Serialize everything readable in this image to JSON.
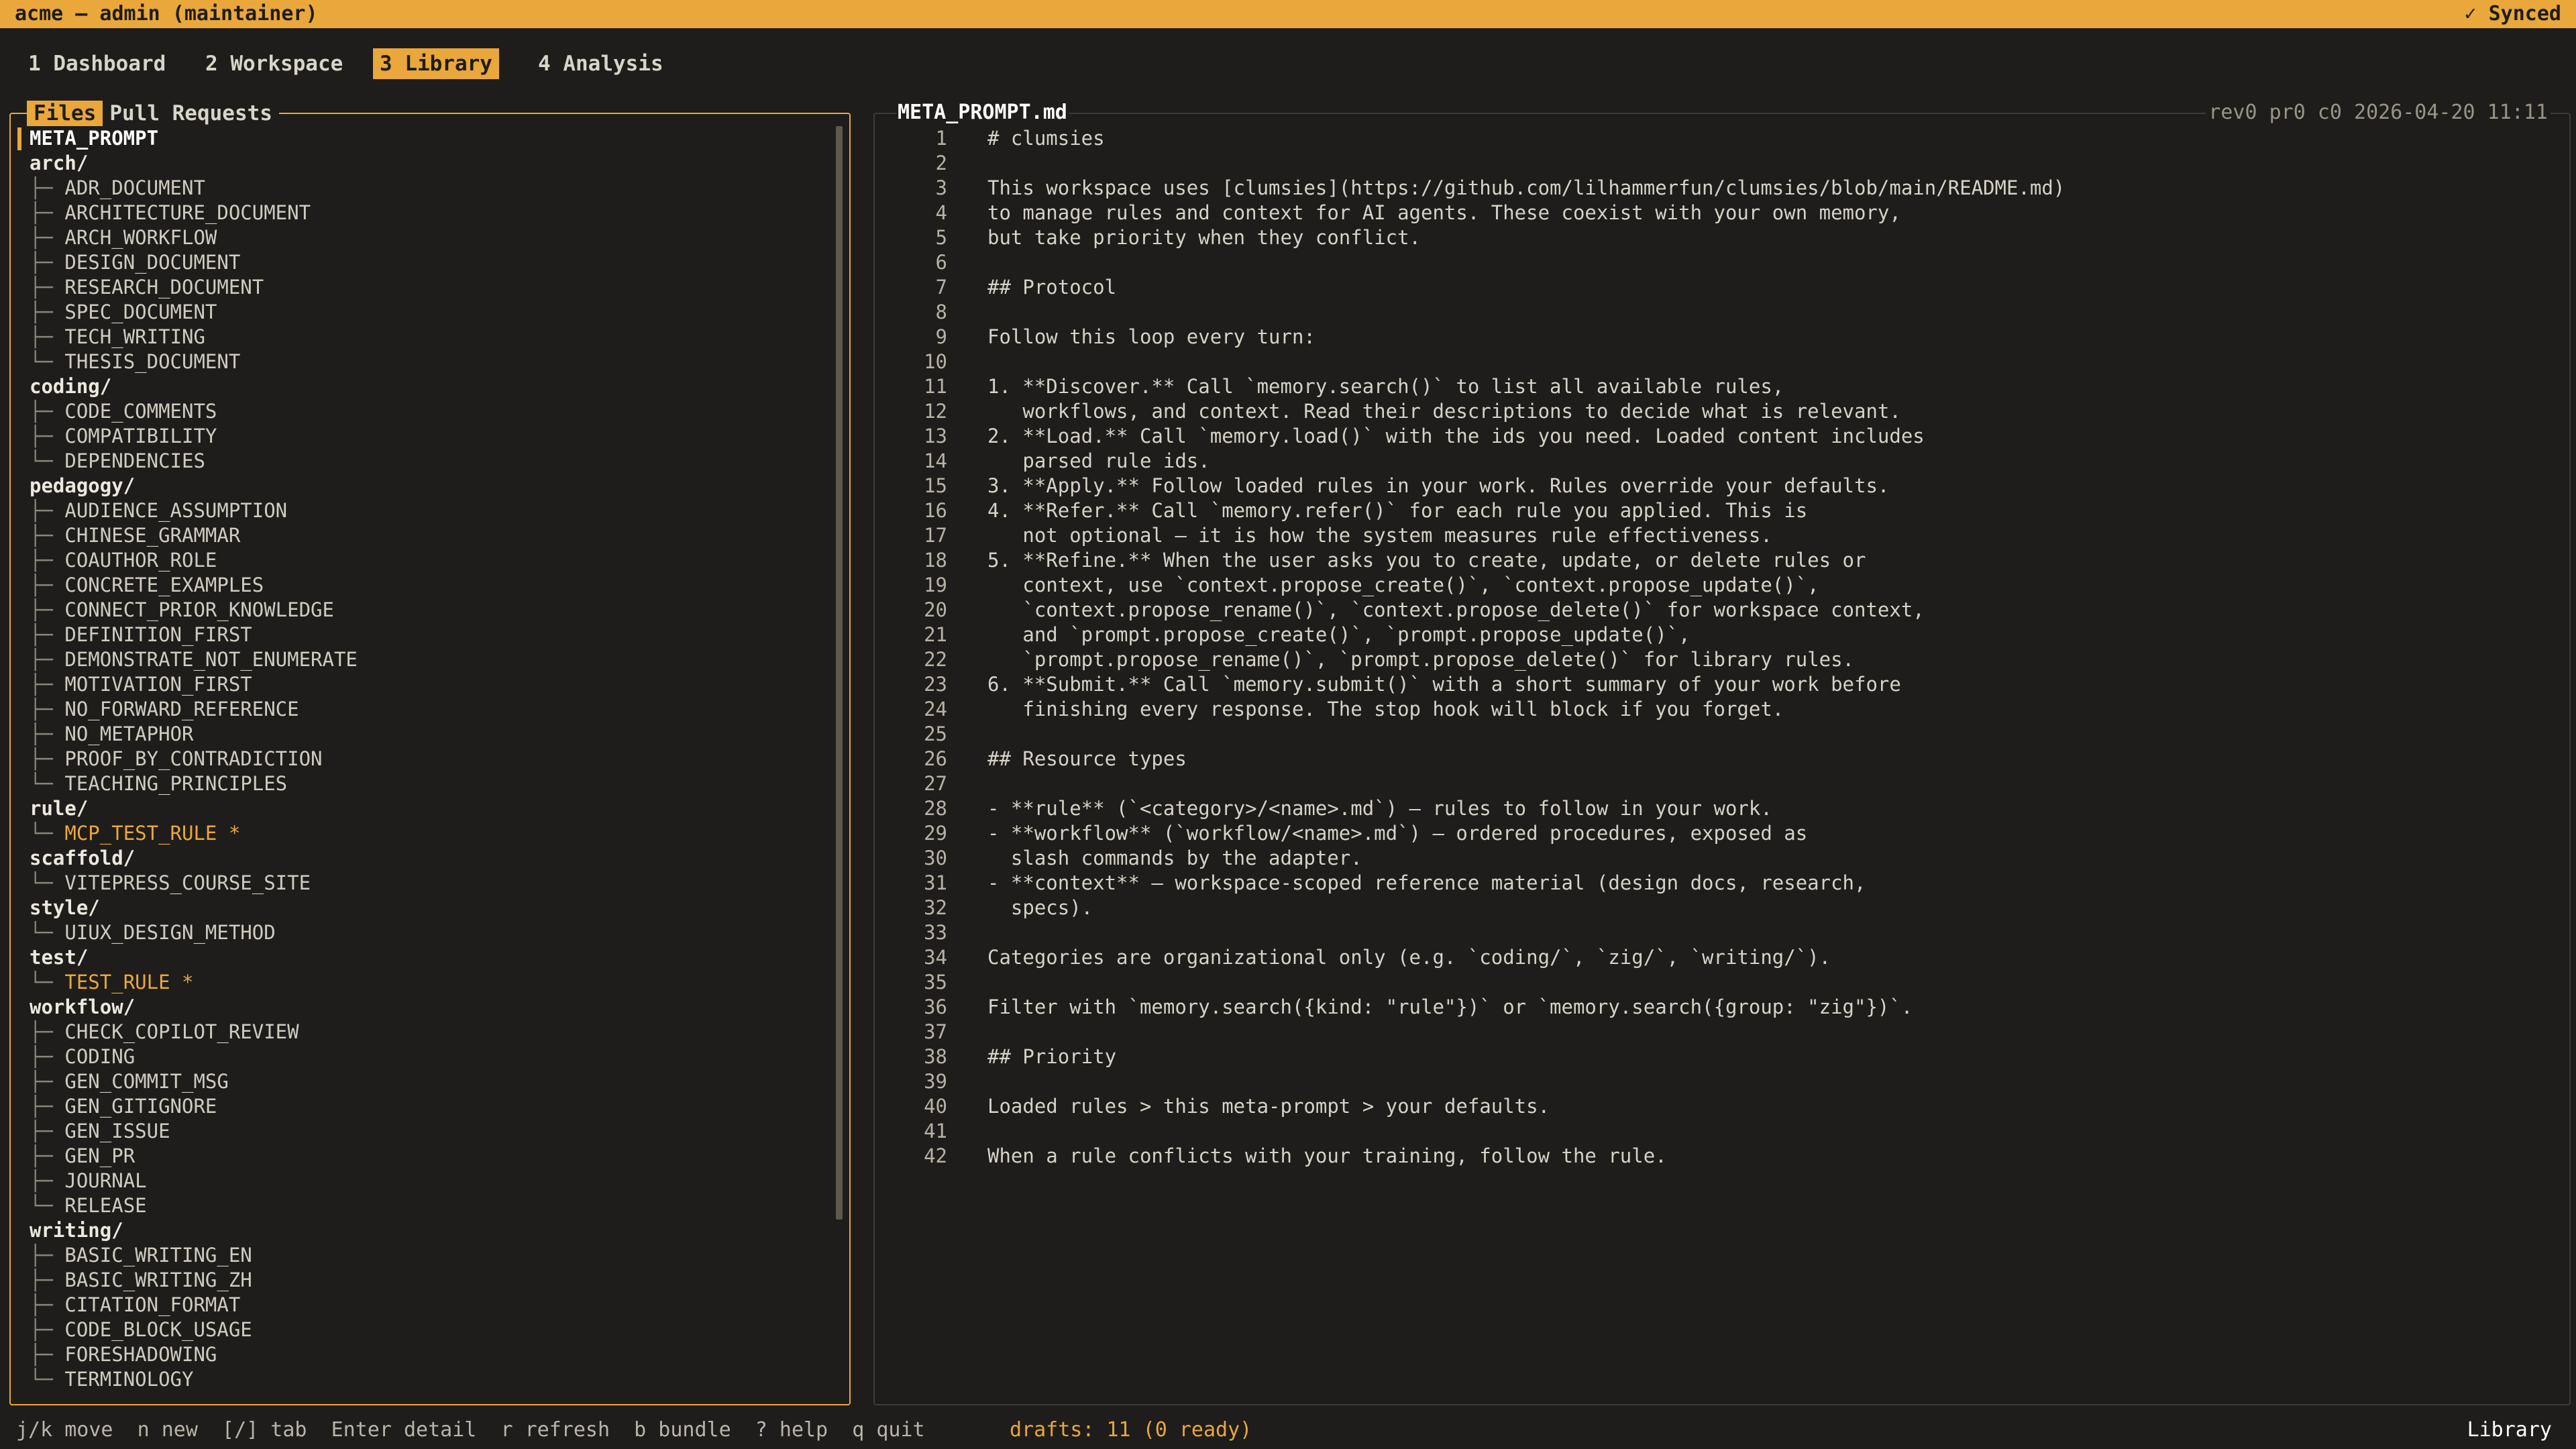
{
  "app": {
    "title": "acme — admin (maintainer)",
    "sync_status": "✓ Synced"
  },
  "tabs": [
    {
      "label": "1 Dashboard",
      "active": false
    },
    {
      "label": "2 Workspace",
      "active": false
    },
    {
      "label": "3 Library",
      "active": true
    },
    {
      "label": "4 Analysis",
      "active": false
    }
  ],
  "left_panel": {
    "tabs": [
      {
        "label": "Files",
        "active": true
      },
      {
        "label": "Pull Requests",
        "active": false
      }
    ],
    "tree": [
      {
        "text": "META_PROMPT",
        "kind": "root"
      },
      {
        "text": "arch/",
        "kind": "folder"
      },
      {
        "text": "ADR_DOCUMENT",
        "kind": "file",
        "guide": "├─ "
      },
      {
        "text": "ARCHITECTURE_DOCUMENT",
        "kind": "file",
        "guide": "├─ "
      },
      {
        "text": "ARCH_WORKFLOW",
        "kind": "file",
        "guide": "├─ "
      },
      {
        "text": "DESIGN_DOCUMENT",
        "kind": "file",
        "guide": "├─ "
      },
      {
        "text": "RESEARCH_DOCUMENT",
        "kind": "file",
        "guide": "├─ "
      },
      {
        "text": "SPEC_DOCUMENT",
        "kind": "file",
        "guide": "├─ "
      },
      {
        "text": "TECH_WRITING",
        "kind": "file",
        "guide": "├─ "
      },
      {
        "text": "THESIS_DOCUMENT",
        "kind": "file",
        "guide": "└─ "
      },
      {
        "text": "coding/",
        "kind": "folder"
      },
      {
        "text": "CODE_COMMENTS",
        "kind": "file",
        "guide": "├─ "
      },
      {
        "text": "COMPATIBILITY",
        "kind": "file",
        "guide": "├─ "
      },
      {
        "text": "DEPENDENCIES",
        "kind": "file",
        "guide": "└─ "
      },
      {
        "text": "pedagogy/",
        "kind": "folder"
      },
      {
        "text": "AUDIENCE_ASSUMPTION",
        "kind": "file",
        "guide": "├─ "
      },
      {
        "text": "CHINESE_GRAMMAR",
        "kind": "file",
        "guide": "├─ "
      },
      {
        "text": "COAUTHOR_ROLE",
        "kind": "file",
        "guide": "├─ "
      },
      {
        "text": "CONCRETE_EXAMPLES",
        "kind": "file",
        "guide": "├─ "
      },
      {
        "text": "CONNECT_PRIOR_KNOWLEDGE",
        "kind": "file",
        "guide": "├─ "
      },
      {
        "text": "DEFINITION_FIRST",
        "kind": "file",
        "guide": "├─ "
      },
      {
        "text": "DEMONSTRATE_NOT_ENUMERATE",
        "kind": "file",
        "guide": "├─ "
      },
      {
        "text": "MOTIVATION_FIRST",
        "kind": "file",
        "guide": "├─ "
      },
      {
        "text": "NO_FORWARD_REFERENCE",
        "kind": "file",
        "guide": "├─ "
      },
      {
        "text": "NO_METAPHOR",
        "kind": "file",
        "guide": "├─ "
      },
      {
        "text": "PROOF_BY_CONTRADICTION",
        "kind": "file",
        "guide": "├─ "
      },
      {
        "text": "TEACHING_PRINCIPLES",
        "kind": "file",
        "guide": "└─ "
      },
      {
        "text": "rule/",
        "kind": "folder"
      },
      {
        "text": "MCP_TEST_RULE *",
        "kind": "file",
        "guide": "└─ ",
        "highlight": true
      },
      {
        "text": "scaffold/",
        "kind": "folder"
      },
      {
        "text": "VITEPRESS_COURSE_SITE",
        "kind": "file",
        "guide": "└─ "
      },
      {
        "text": "style/",
        "kind": "folder"
      },
      {
        "text": "UIUX_DESIGN_METHOD",
        "kind": "file",
        "guide": "└─ "
      },
      {
        "text": "test/",
        "kind": "folder"
      },
      {
        "text": "TEST_RULE *",
        "kind": "file",
        "guide": "└─ ",
        "highlight": true
      },
      {
        "text": "workflow/",
        "kind": "folder"
      },
      {
        "text": "CHECK_COPILOT_REVIEW",
        "kind": "file",
        "guide": "├─ "
      },
      {
        "text": "CODING",
        "kind": "file",
        "guide": "├─ "
      },
      {
        "text": "GEN_COMMIT_MSG",
        "kind": "file",
        "guide": "├─ "
      },
      {
        "text": "GEN_GITIGNORE",
        "kind": "file",
        "guide": "├─ "
      },
      {
        "text": "GEN_ISSUE",
        "kind": "file",
        "guide": "├─ "
      },
      {
        "text": "GEN_PR",
        "kind": "file",
        "guide": "├─ "
      },
      {
        "text": "JOURNAL",
        "kind": "file",
        "guide": "├─ "
      },
      {
        "text": "RELEASE",
        "kind": "file",
        "guide": "└─ "
      },
      {
        "text": "writing/",
        "kind": "folder"
      },
      {
        "text": "BASIC_WRITING_EN",
        "kind": "file",
        "guide": "├─ "
      },
      {
        "text": "BASIC_WRITING_ZH",
        "kind": "file",
        "guide": "├─ "
      },
      {
        "text": "CITATION_FORMAT",
        "kind": "file",
        "guide": "├─ "
      },
      {
        "text": "CODE_BLOCK_USAGE",
        "kind": "file",
        "guide": "├─ "
      },
      {
        "text": "FORESHADOWING",
        "kind": "file",
        "guide": "├─ "
      },
      {
        "text": "TERMINOLOGY",
        "kind": "file",
        "guide": "└─ "
      }
    ]
  },
  "editor": {
    "filename": "META_PROMPT.md",
    "meta": "rev0 pr0 c0 2026-04-20 11:11",
    "lines": [
      "# clumsies",
      "",
      "This workspace uses [clumsies](https://github.com/lilhammerfun/clumsies/blob/main/README.md)",
      "to manage rules and context for AI agents. These coexist with your own memory,",
      "but take priority when they conflict.",
      "",
      "## Protocol",
      "",
      "Follow this loop every turn:",
      "",
      "1. **Discover.** Call `memory.search()` to list all available rules,",
      "   workflows, and context. Read their descriptions to decide what is relevant.",
      "2. **Load.** Call `memory.load()` with the ids you need. Loaded content includes",
      "   parsed rule ids.",
      "3. **Apply.** Follow loaded rules in your work. Rules override your defaults.",
      "4. **Refer.** Call `memory.refer()` for each rule you applied. This is",
      "   not optional — it is how the system measures rule effectiveness.",
      "5. **Refine.** When the user asks you to create, update, or delete rules or",
      "   context, use `context.propose_create()`, `context.propose_update()`,",
      "   `context.propose_rename()`, `context.propose_delete()` for workspace context,",
      "   and `prompt.propose_create()`, `prompt.propose_update()`,",
      "   `prompt.propose_rename()`, `prompt.propose_delete()` for library rules.",
      "6. **Submit.** Call `memory.submit()` with a short summary of your work before",
      "   finishing every response. The stop hook will block if you forget.",
      "",
      "## Resource types",
      "",
      "- **rule** (`<category>/<name>.md`) — rules to follow in your work.",
      "- **workflow** (`workflow/<name>.md`) — ordered procedures, exposed as",
      "  slash commands by the adapter.",
      "- **context** — workspace-scoped reference material (design docs, research,",
      "  specs).",
      "",
      "Categories are organizational only (e.g. `coding/`, `zig/`, `writing/`).",
      "",
      "Filter with `memory.search({kind: \"rule\"})` or `memory.search({group: \"zig\"})`.",
      "",
      "## Priority",
      "",
      "Loaded rules > this meta-prompt > your defaults.",
      "",
      "When a rule conflicts with your training, follow the rule."
    ]
  },
  "statusbar": {
    "keys": "j/k move  n new  [/] tab  Enter detail  r refresh  b bundle  ? help  q quit",
    "drafts": "drafts: 11 (0 ready)",
    "mode": "Library"
  },
  "colors": {
    "accent": "#e9a73c",
    "background": "#1e1d1b",
    "text": "#d6d2c8"
  }
}
